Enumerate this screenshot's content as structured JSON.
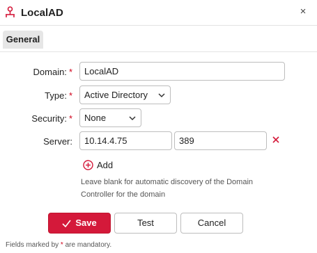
{
  "dialog": {
    "title": "LocalAD",
    "close_symbol": "×"
  },
  "tabs": [
    {
      "label": "General",
      "active": true
    }
  ],
  "form": {
    "domain": {
      "label": "Domain:",
      "required": "*",
      "value": "LocalAD"
    },
    "type": {
      "label": "Type:",
      "required": "*",
      "value": "Active Directory"
    },
    "security": {
      "label": "Security:",
      "required": "*",
      "value": "None"
    },
    "server": {
      "label": "Server:",
      "host": "10.14.4.75",
      "port": "389"
    },
    "add_label": "Add",
    "hint": "Leave blank for automatic discovery of the Domain Controller for the domain"
  },
  "buttons": {
    "save": "Save",
    "test": "Test",
    "cancel": "Cancel"
  },
  "footnote": {
    "before": "Fields marked by ",
    "mark": "*",
    "after": " are mandatory."
  },
  "colors": {
    "accent": "#d4193a",
    "required": "#d0021b"
  },
  "icons": {
    "title": "network-server-icon",
    "remove": "remove-x-icon",
    "add": "add-circle-icon",
    "save": "checkmark-icon"
  }
}
